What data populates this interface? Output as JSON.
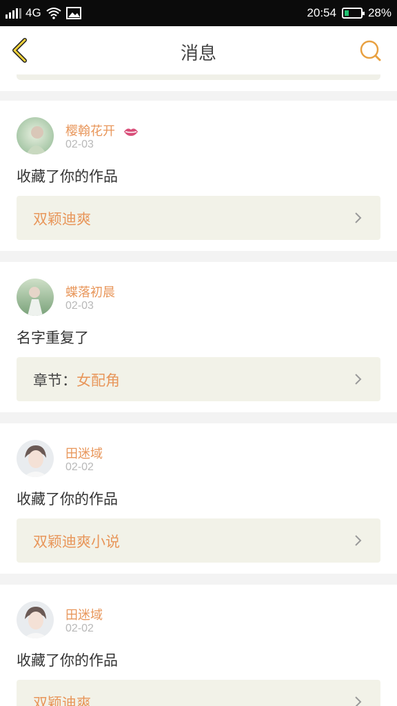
{
  "status_bar": {
    "network": "4G",
    "time": "20:54",
    "battery": "28%",
    "battery_level": 0.28,
    "icons": [
      "signal-icon",
      "wifi-icon",
      "image-icon",
      "battery-icon"
    ]
  },
  "nav": {
    "title": "消息",
    "back_icon": "chevron-left-icon",
    "search_icon": "search-icon",
    "accent": "#e8a040"
  },
  "colors": {
    "name": "#e8965a",
    "date": "#b8b8b8",
    "link_bg": "#f2f2e8"
  },
  "messages": [
    {
      "user": "樱翰花开",
      "has_badge": true,
      "badge_icon": "lips-icon",
      "date": "02-03",
      "text": "收藏了你的作品",
      "link_prefix": "",
      "link": "双颖迪爽"
    },
    {
      "user": "蝶落初晨",
      "has_badge": false,
      "date": "02-03",
      "text": "名字重复了",
      "link_prefix": "章节：",
      "link": "女配角"
    },
    {
      "user": "田迷域",
      "has_badge": false,
      "date": "02-02",
      "text": "收藏了你的作品",
      "link_prefix": "",
      "link": "双颖迪爽小说"
    },
    {
      "user": "田迷域",
      "has_badge": false,
      "date": "02-02",
      "text": "收藏了你的作品",
      "link_prefix": "",
      "link": "双颖迪爽"
    }
  ]
}
